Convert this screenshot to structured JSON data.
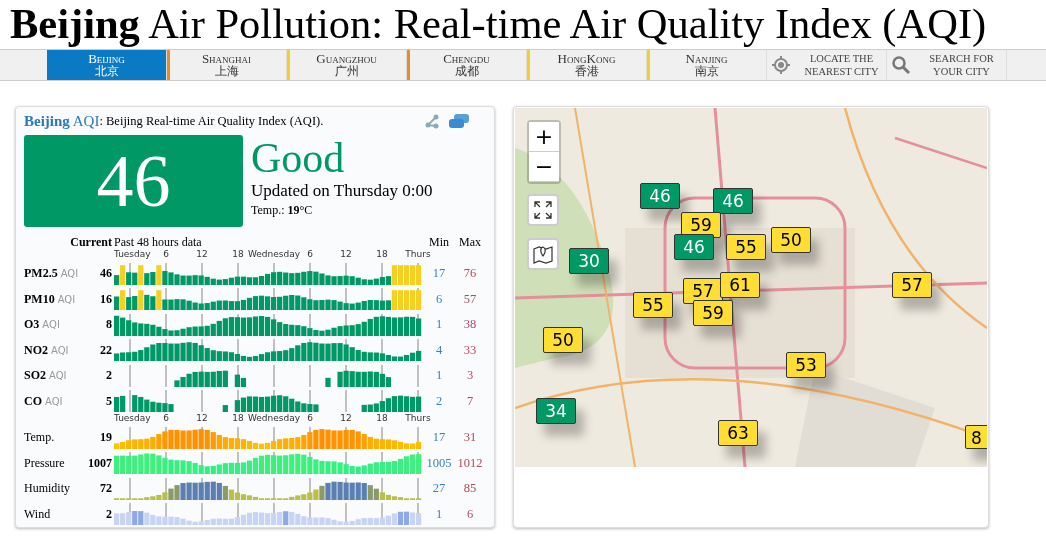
{
  "page_title": "**Beijing** Air Pollution: Real-time Air Quality Index (AQI)",
  "city_tabs": [
    {
      "label": "Beijing",
      "label_zh": "北京",
      "selected": true
    },
    {
      "label": "Shanghai",
      "label_zh": "上海",
      "selected": false,
      "color": "#f08a24"
    },
    {
      "label": "Guangzhou",
      "label_zh": "广州",
      "selected": false,
      "color": "#f5d020"
    },
    {
      "label": "Chengdu",
      "label_zh": "成都",
      "selected": false,
      "color": "#f08a24"
    },
    {
      "label": "HongKong",
      "label_zh": "香港",
      "selected": false,
      "color": "#f5d020"
    },
    {
      "label": "Nanjing",
      "label_zh": "南京",
      "selected": false,
      "color": "#f5d020"
    }
  ],
  "tools": [
    {
      "kind": "locate",
      "line1": "LOCATE THE",
      "line2": "NEAREST CITY"
    },
    {
      "kind": "search",
      "line1": "SEARCH FOR",
      "line2": "YOUR CITY"
    }
  ],
  "aqi_card": {
    "link": "**Beijing** AQI",
    "subtitle": ": Beijing Real-time Air Quality Index (AQI).",
    "aqi": "46",
    "level": "Good",
    "updated": "Updated on Thursday 0:00",
    "temperature": "Temp.: **19**°C",
    "header": {
      "current": "Current",
      "past": "Past 48 hours data",
      "min": "Min",
      "max": "Max"
    },
    "axes": [
      [
        "Tuesday",
        "6",
        "12",
        "18",
        "Wednesday",
        "6",
        "12",
        "18",
        "Thurs"
      ],
      [
        "Tuesday",
        "6",
        "12",
        "18",
        "Wednesday",
        "6",
        "12",
        "18",
        "Thurs"
      ]
    ],
    "pollutant_rows": [
      {
        "name": "PM2.5",
        "unit": "AQI",
        "current": "46",
        "min": "17",
        "max": "76",
        "kind": "pm25"
      },
      {
        "name": "PM10",
        "unit": "AQI",
        "current": "16",
        "min": "6",
        "max": "57",
        "kind": "pm10"
      },
      {
        "name": "O3",
        "unit": "AQI",
        "current": "8",
        "min": "1",
        "max": "38",
        "kind": "o3"
      },
      {
        "name": "NO2",
        "unit": "AQI",
        "current": "22",
        "min": "4",
        "max": "33",
        "kind": "no2"
      },
      {
        "name": "SO2",
        "unit": "AQI",
        "current": "2",
        "min": "1",
        "max": "3",
        "kind": "so2"
      },
      {
        "name": "CO",
        "unit": "AQI",
        "current": "5",
        "min": "2",
        "max": "7",
        "kind": "co"
      }
    ],
    "weather_rows": [
      {
        "name": "Temp.",
        "current": "19",
        "min": "17",
        "max": "31",
        "kind": "temperature"
      },
      {
        "name": "Pressure",
        "current": "1007",
        "min": "1005",
        "max": "1012",
        "kind": "pressure"
      },
      {
        "name": "Humidity",
        "current": "72",
        "min": "27",
        "max": "85",
        "kind": "humidity"
      },
      {
        "name": "Wind",
        "current": "2",
        "min": "1",
        "max": "6",
        "kind": "wind"
      }
    ]
  },
  "map": {
    "kind": "picture",
    "zoom_in": "+",
    "zoom_out": "−",
    "markers": [
      {
        "value": "46",
        "color": "#009966"
      },
      {
        "value": "46",
        "color": "#009966"
      },
      {
        "value": "59",
        "color": "#ffde33"
      },
      {
        "value": "46",
        "color": "#009966"
      },
      {
        "value": "55",
        "color": "#ffde33"
      },
      {
        "value": "50",
        "color": "#ffde33"
      },
      {
        "value": "30",
        "color": "#009966"
      },
      {
        "value": "57",
        "color": "#ffde33"
      },
      {
        "value": "61",
        "color": "#ffde33"
      },
      {
        "value": "55",
        "color": "#ffde33"
      },
      {
        "value": "59",
        "color": "#ffde33"
      },
      {
        "value": "57",
        "color": "#ffde33"
      },
      {
        "value": "50",
        "color": "#ffde33"
      },
      {
        "value": "53",
        "color": "#ffde33"
      },
      {
        "value": "34",
        "color": "#009966"
      },
      {
        "value": "63",
        "color": "#ffde33"
      },
      {
        "value": "8",
        "color": "#ffde33"
      }
    ]
  }
}
